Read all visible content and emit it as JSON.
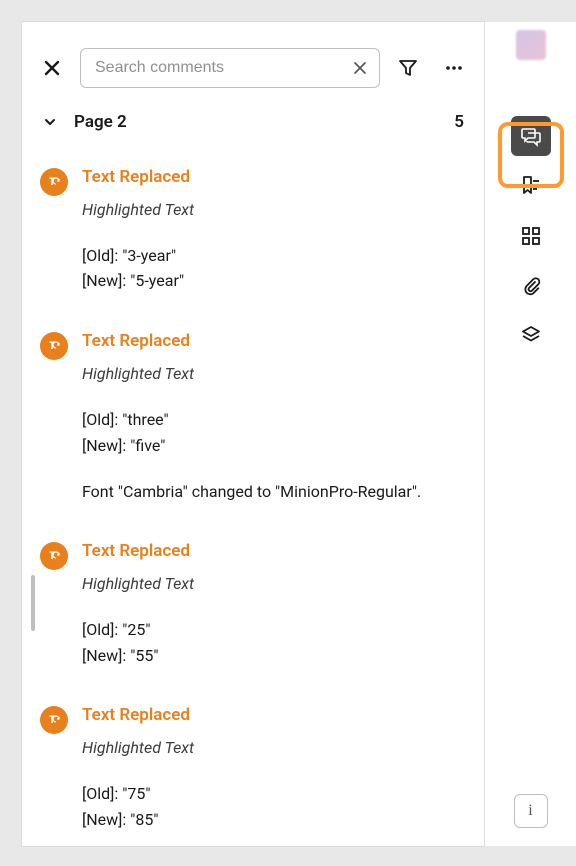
{
  "search": {
    "placeholder": "Search comments"
  },
  "page": {
    "title": "Page 2",
    "count": "5"
  },
  "comments": [
    {
      "title": "Text Replaced",
      "subtitle": "Highlighted Text",
      "old": "[Old]: \"3-year\"",
      "new": "[New]: \"5-year\"",
      "extra": ""
    },
    {
      "title": "Text Replaced",
      "subtitle": "Highlighted Text",
      "old": "[Old]: \"three\"",
      "new": "[New]: \"five\"",
      "extra": "Font \"Cambria\" changed to \"MinionPro-Regular\"."
    },
    {
      "title": "Text Replaced",
      "subtitle": "Highlighted Text",
      "old": "[Old]: \"25\"",
      "new": "[New]: \"55\"",
      "extra": ""
    },
    {
      "title": "Text Replaced",
      "subtitle": "Highlighted Text",
      "old": "[Old]: \"75\"",
      "new": "[New]: \"85\"",
      "extra": ""
    }
  ],
  "info_label": "i"
}
